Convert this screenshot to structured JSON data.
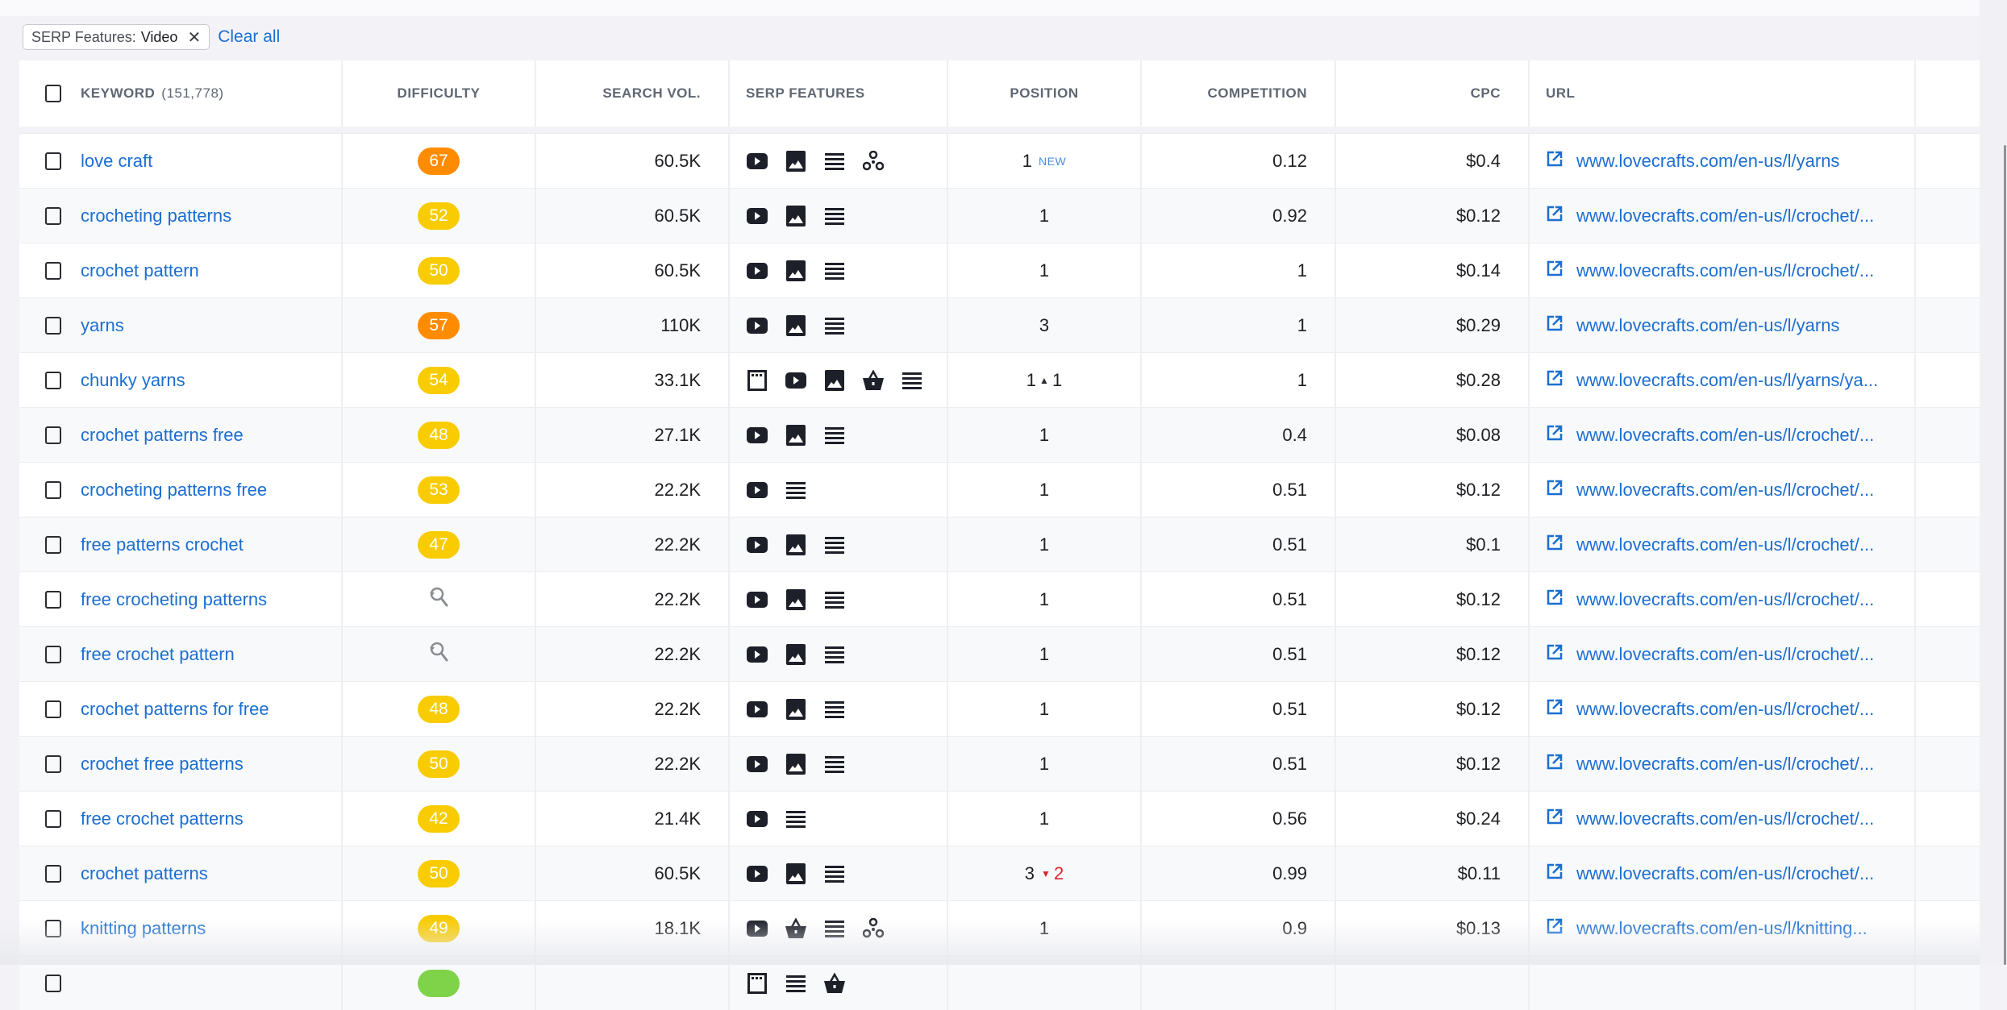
{
  "filters": {
    "chip_key": "SERP Features:",
    "chip_value": "Video",
    "clear_all": "Clear all"
  },
  "table": {
    "headers": {
      "keyword": "KEYWORD",
      "keyword_count": "(151,778)",
      "difficulty": "DIFFICULTY",
      "search_vol": "SEARCH VOL.",
      "serp_features": "SERP FEATURES",
      "position": "POSITION",
      "competition": "COMPETITION",
      "cpc": "CPC",
      "url": "URL"
    },
    "difficulty_colors": {
      "orange": "#ff8c00",
      "yellow": "#f8cc00",
      "green": "#7ed348"
    },
    "rows": [
      {
        "keyword": "love craft",
        "difficulty": "67",
        "diff_color": "orange",
        "volume": "60.5K",
        "serp": [
          "video-icon",
          "image-icon",
          "list-icon",
          "related-icon"
        ],
        "position": "1",
        "pos_badge": "NEW",
        "competition": "0.12",
        "cpc": "$0.4",
        "url": "www.lovecrafts.com/en-us/l/yarns"
      },
      {
        "keyword": "crocheting patterns",
        "difficulty": "52",
        "diff_color": "yellow",
        "volume": "60.5K",
        "serp": [
          "video-icon",
          "image-icon",
          "list-icon"
        ],
        "position": "1",
        "competition": "0.92",
        "cpc": "$0.12",
        "url": "www.lovecrafts.com/en-us/l/crochet/..."
      },
      {
        "keyword": "crochet pattern",
        "difficulty": "50",
        "diff_color": "yellow",
        "volume": "60.5K",
        "serp": [
          "video-icon",
          "image-icon",
          "list-icon"
        ],
        "position": "1",
        "competition": "1",
        "cpc": "$0.14",
        "url": "www.lovecrafts.com/en-us/l/crochet/..."
      },
      {
        "keyword": "yarns",
        "difficulty": "57",
        "diff_color": "orange",
        "volume": "110K",
        "serp": [
          "video-icon",
          "image-icon",
          "list-icon"
        ],
        "position": "3",
        "competition": "1",
        "cpc": "$0.29",
        "url": "www.lovecrafts.com/en-us/l/yarns"
      },
      {
        "keyword": "chunky yarns",
        "difficulty": "54",
        "diff_color": "yellow",
        "volume": "33.1K",
        "serp": [
          "ads-icon",
          "video-icon",
          "image-icon",
          "shopping-icon",
          "list-icon"
        ],
        "position": "1",
        "pos_up": "1",
        "competition": "1",
        "cpc": "$0.28",
        "url": "www.lovecrafts.com/en-us/l/yarns/ya..."
      },
      {
        "keyword": "crochet patterns free",
        "difficulty": "48",
        "diff_color": "yellow",
        "volume": "27.1K",
        "serp": [
          "video-icon",
          "image-icon",
          "list-icon"
        ],
        "position": "1",
        "competition": "0.4",
        "cpc": "$0.08",
        "url": "www.lovecrafts.com/en-us/l/crochet/..."
      },
      {
        "keyword": "crocheting patterns free",
        "difficulty": "53",
        "diff_color": "yellow",
        "volume": "22.2K",
        "serp": [
          "video-icon",
          "list-icon"
        ],
        "position": "1",
        "competition": "0.51",
        "cpc": "$0.12",
        "url": "www.lovecrafts.com/en-us/l/crochet/..."
      },
      {
        "keyword": "free patterns crochet",
        "difficulty": "47",
        "diff_color": "yellow",
        "volume": "22.2K",
        "serp": [
          "video-icon",
          "image-icon",
          "list-icon"
        ],
        "position": "1",
        "competition": "0.51",
        "cpc": "$0.1",
        "url": "www.lovecrafts.com/en-us/l/crochet/..."
      },
      {
        "keyword": "free crocheting patterns",
        "difficulty": "",
        "diff_icon": "refresh-search-icon",
        "volume": "22.2K",
        "serp": [
          "video-icon",
          "image-icon",
          "list-icon"
        ],
        "position": "1",
        "competition": "0.51",
        "cpc": "$0.12",
        "url": "www.lovecrafts.com/en-us/l/crochet/..."
      },
      {
        "keyword": "free crochet pattern",
        "difficulty": "",
        "diff_icon": "refresh-search-icon",
        "volume": "22.2K",
        "serp": [
          "video-icon",
          "image-icon",
          "list-icon"
        ],
        "position": "1",
        "competition": "0.51",
        "cpc": "$0.12",
        "url": "www.lovecrafts.com/en-us/l/crochet/..."
      },
      {
        "keyword": "crochet patterns for free",
        "difficulty": "48",
        "diff_color": "yellow",
        "volume": "22.2K",
        "serp": [
          "video-icon",
          "image-icon",
          "list-icon"
        ],
        "position": "1",
        "competition": "0.51",
        "cpc": "$0.12",
        "url": "www.lovecrafts.com/en-us/l/crochet/..."
      },
      {
        "keyword": "crochet free patterns",
        "difficulty": "50",
        "diff_color": "yellow",
        "volume": "22.2K",
        "serp": [
          "video-icon",
          "image-icon",
          "list-icon"
        ],
        "position": "1",
        "competition": "0.51",
        "cpc": "$0.12",
        "url": "www.lovecrafts.com/en-us/l/crochet/..."
      },
      {
        "keyword": "free crochet patterns",
        "difficulty": "42",
        "diff_color": "yellow",
        "volume": "21.4K",
        "serp": [
          "video-icon",
          "list-icon"
        ],
        "position": "1",
        "competition": "0.56",
        "cpc": "$0.24",
        "url": "www.lovecrafts.com/en-us/l/crochet/..."
      },
      {
        "keyword": "crochet patterns",
        "difficulty": "50",
        "diff_color": "yellow",
        "volume": "60.5K",
        "serp": [
          "video-icon",
          "image-icon",
          "list-icon"
        ],
        "position": "3",
        "pos_down": "2",
        "competition": "0.99",
        "cpc": "$0.11",
        "url": "www.lovecrafts.com/en-us/l/crochet/..."
      },
      {
        "keyword": "knitting patterns",
        "difficulty": "49",
        "diff_color": "yellow",
        "volume": "18.1K",
        "serp": [
          "video-icon",
          "shopping-icon",
          "list-icon",
          "related-icon"
        ],
        "position": "1",
        "competition": "0.9",
        "cpc": "$0.13",
        "url": "www.lovecrafts.com/en-us/l/knitting..."
      },
      {
        "keyword": "",
        "difficulty": "",
        "diff_color": "green",
        "volume": "",
        "serp": [
          "ads-icon",
          "list-icon",
          "shopping-icon"
        ],
        "position": "",
        "competition": "",
        "cpc": "",
        "url": "",
        "partial": true
      }
    ]
  }
}
